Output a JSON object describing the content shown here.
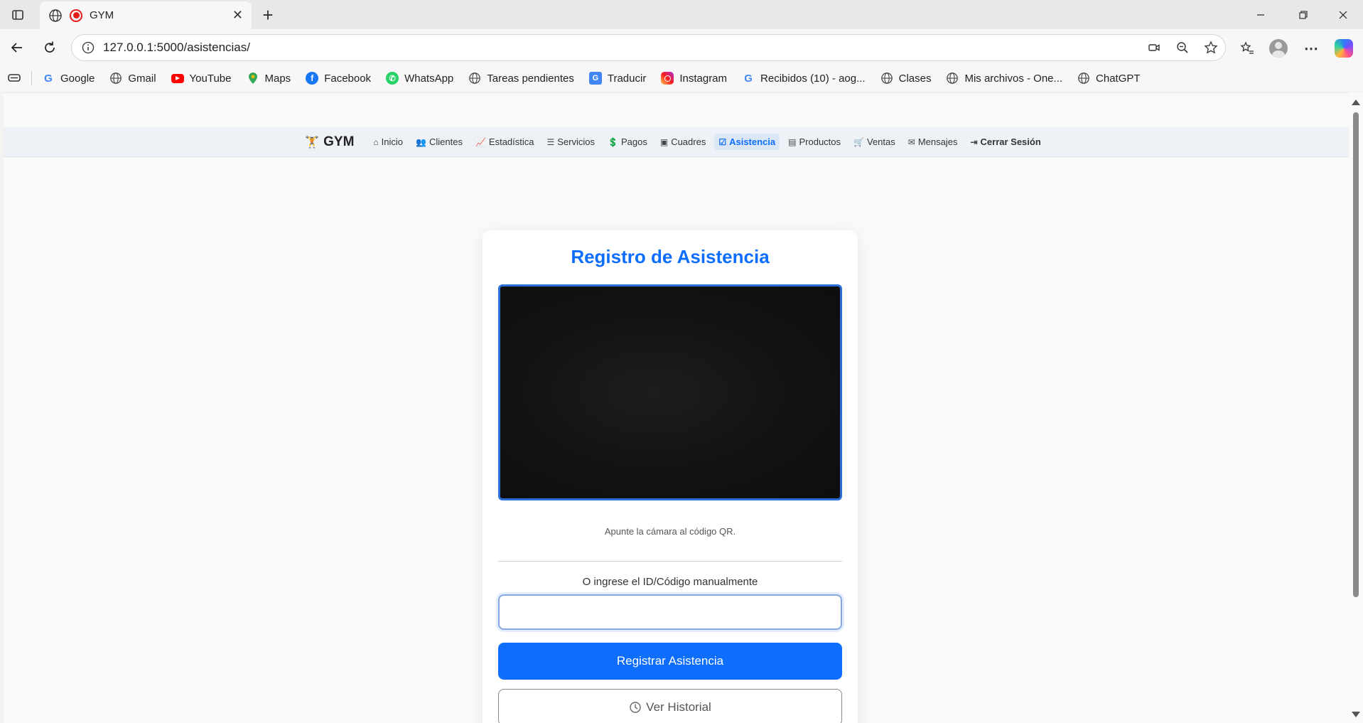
{
  "browser": {
    "tab_title": "GYM",
    "url": "127.0.0.1:5000/asistencias/",
    "bookmarks": [
      {
        "label": "Google",
        "icon": "google-icon",
        "color": "#4285f4"
      },
      {
        "label": "Gmail",
        "icon": "globe-icon",
        "color": "#555555"
      },
      {
        "label": "YouTube",
        "icon": "youtube-icon",
        "color": "#ff0000"
      },
      {
        "label": "Maps",
        "icon": "maps-icon",
        "color": "#34a853"
      },
      {
        "label": "Facebook",
        "icon": "facebook-icon",
        "color": "#1877f2"
      },
      {
        "label": "WhatsApp",
        "icon": "whatsapp-icon",
        "color": "#25d366"
      },
      {
        "label": "Tareas pendientes",
        "icon": "globe-icon",
        "color": "#555555"
      },
      {
        "label": "Traducir",
        "icon": "translate-icon",
        "color": "#4285f4"
      },
      {
        "label": "Instagram",
        "icon": "instagram-icon",
        "color": "#d6249f"
      },
      {
        "label": "Recibidos (10) - aog...",
        "icon": "google-icon",
        "color": "#4285f4"
      },
      {
        "label": "Clases",
        "icon": "globe-icon",
        "color": "#555555"
      },
      {
        "label": "Mis archivos - One...",
        "icon": "globe-icon",
        "color": "#555555"
      },
      {
        "label": "ChatGPT",
        "icon": "globe-icon",
        "color": "#555555"
      }
    ]
  },
  "app": {
    "brand": "GYM",
    "nav": [
      {
        "label": "Inicio",
        "icon": "home-icon",
        "glyph": "⌂"
      },
      {
        "label": "Clientes",
        "icon": "users-icon",
        "glyph": "👥"
      },
      {
        "label": "Estadística",
        "icon": "chart-icon",
        "glyph": "📈"
      },
      {
        "label": "Servicios",
        "icon": "list-icon",
        "glyph": "☰"
      },
      {
        "label": "Pagos",
        "icon": "cash-icon",
        "glyph": "💲"
      },
      {
        "label": "Cuadres",
        "icon": "register-icon",
        "glyph": "▣"
      },
      {
        "label": "Asistencia",
        "icon": "calendar-check-icon",
        "glyph": "☑",
        "active": true
      },
      {
        "label": "Productos",
        "icon": "shop-icon",
        "glyph": "▤"
      },
      {
        "label": "Ventas",
        "icon": "cart-icon",
        "glyph": "🛒"
      },
      {
        "label": "Mensajes",
        "icon": "envelope-icon",
        "glyph": "✉"
      },
      {
        "label": "Cerrar Sesión",
        "icon": "logout-icon",
        "glyph": "⇥"
      }
    ],
    "accent_color": "#0d6efd"
  },
  "attendance": {
    "title": "Registro de Asistencia",
    "hint": "Apunte la cámara al código QR.",
    "manual_label": "O ingrese el ID/Código manualmente",
    "manual_value": "",
    "register_button": "Registrar Asistencia",
    "history_button": "Ver Historial"
  }
}
